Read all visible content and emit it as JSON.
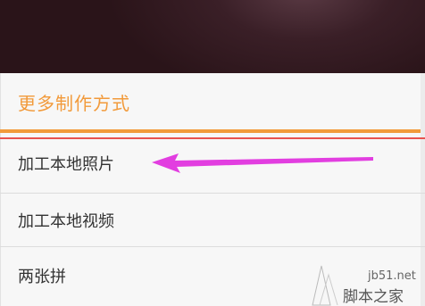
{
  "sheet": {
    "title": "更多制作方式",
    "items": [
      {
        "label": "加工本地照片"
      },
      {
        "label": "加工本地视频"
      },
      {
        "label": "两张拼"
      }
    ]
  },
  "watermark": {
    "site": "jb51.net",
    "brand": "脚本之家"
  },
  "colors": {
    "accent": "#f29a3a",
    "annotation_arrow": "#e23ee0",
    "annotation_line": "#e8534f"
  }
}
